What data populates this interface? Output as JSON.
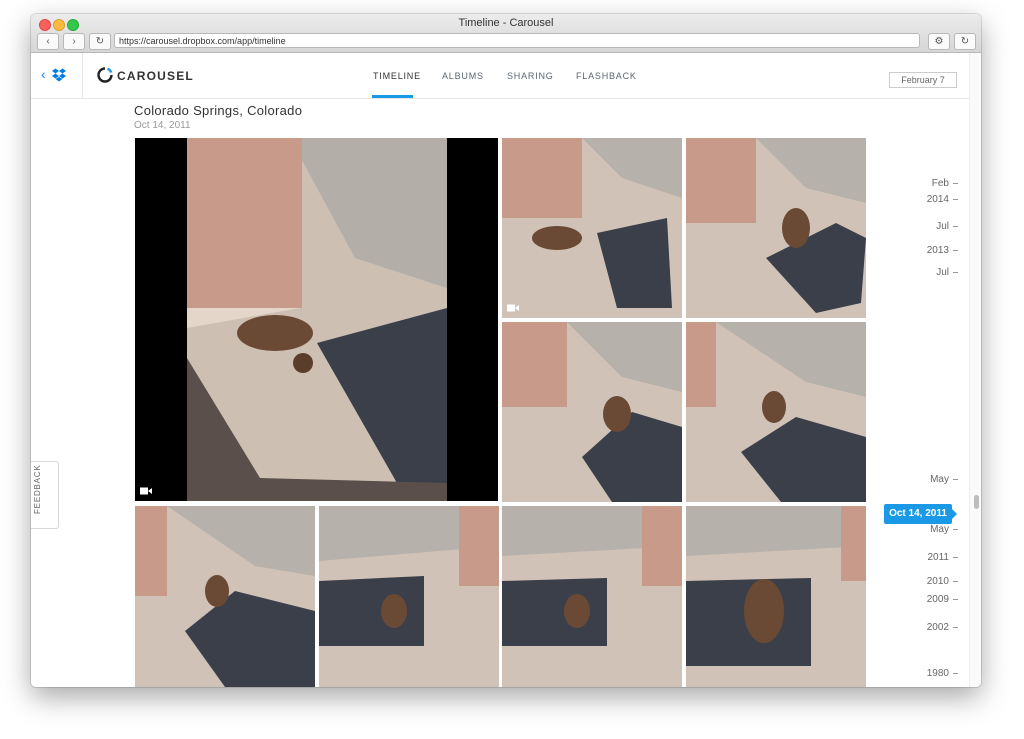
{
  "window": {
    "title": "Timeline - Carousel"
  },
  "browser": {
    "url": "https://carousel.dropbox.com/app/timeline"
  },
  "header": {
    "brand": "CAROUSEL",
    "tabs": [
      {
        "label": "TIMELINE",
        "active": true
      },
      {
        "label": "ALBUMS",
        "active": false
      },
      {
        "label": "SHARING",
        "active": false
      },
      {
        "label": "FLASHBACK",
        "active": false
      }
    ]
  },
  "main": {
    "location": "Colorado Springs, Colorado",
    "date": "Oct 14, 2011"
  },
  "feedback": {
    "label": "FEEDBACK"
  },
  "timeline": {
    "tooltip": "February 7",
    "current": "Oct 14, 2011",
    "items": [
      "Feb",
      "2014",
      "Jul",
      "2013",
      "Jul",
      "May",
      "May",
      "2011",
      "2010",
      "2009",
      "2002",
      "1980"
    ]
  },
  "colors": {
    "accent": "#1a9ae6",
    "dropbox": "#007ee5"
  },
  "icons": {
    "video": "video-camera-icon",
    "back": "chevron-left-icon"
  }
}
